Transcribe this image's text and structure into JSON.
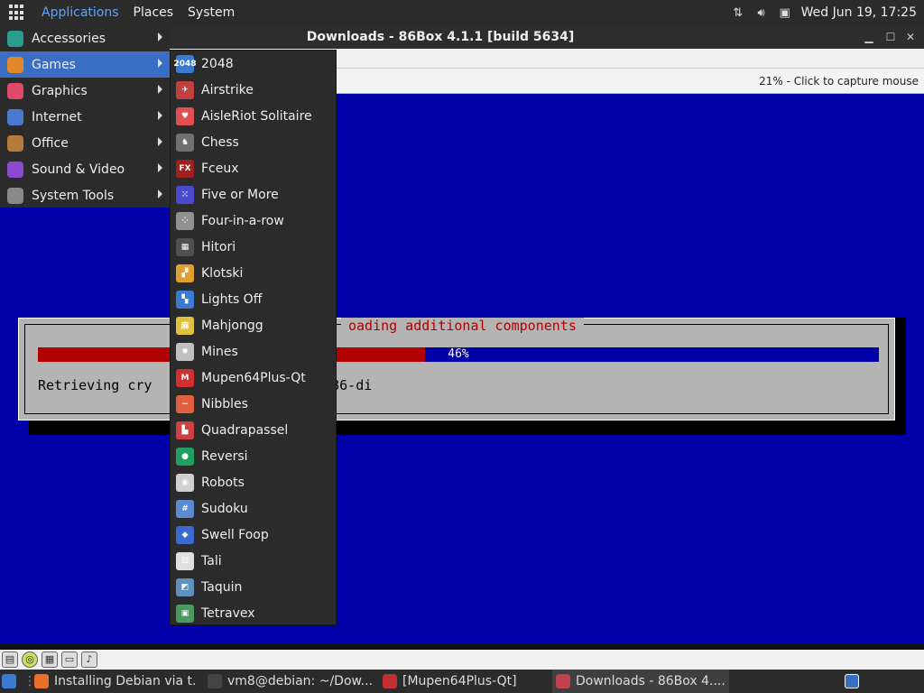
{
  "top_panel": {
    "menus": [
      "Applications",
      "Places",
      "System"
    ],
    "clock": "Wed Jun 19, 17:25"
  },
  "window": {
    "title": "Downloads - 86Box 4.1.1 [build 5634]",
    "status": "21% - Click to capture mouse"
  },
  "installer": {
    "title": "oading additional components",
    "progress_percent": 46,
    "progress_label": "46%",
    "retrieving_text": "Retrieving cry                  18-686-di"
  },
  "apps_menu": [
    {
      "label": "Accessories",
      "icon": "accessories-icon",
      "color": "#2a9d8f"
    },
    {
      "label": "Games",
      "icon": "games-icon",
      "color": "#e0882a"
    },
    {
      "label": "Graphics",
      "icon": "graphics-icon",
      "color": "#e04a6a"
    },
    {
      "label": "Internet",
      "icon": "internet-icon",
      "color": "#4a7ad0"
    },
    {
      "label": "Office",
      "icon": "office-icon",
      "color": "#b87a3a"
    },
    {
      "label": "Sound & Video",
      "icon": "sound-video-icon",
      "color": "#8a4ad0"
    },
    {
      "label": "System Tools",
      "icon": "system-tools-icon",
      "color": "#888888"
    }
  ],
  "games_menu": [
    {
      "label": "2048",
      "icon": "2048-icon",
      "color": "#3a7ad0",
      "glyph": "2048"
    },
    {
      "label": "Airstrike",
      "icon": "airstrike-icon",
      "color": "#c04040",
      "glyph": "✈"
    },
    {
      "label": "AisleRiot Solitaire",
      "icon": "aisleriot-icon",
      "color": "#e05050",
      "glyph": "♥"
    },
    {
      "label": "Chess",
      "icon": "chess-icon",
      "color": "#707070",
      "glyph": "♞"
    },
    {
      "label": "Fceux",
      "icon": "fceux-icon",
      "color": "#a02020",
      "glyph": "FX"
    },
    {
      "label": "Five or More",
      "icon": "five-or-more-icon",
      "color": "#4a4ad0",
      "glyph": "⁙"
    },
    {
      "label": "Four-in-a-row",
      "icon": "four-in-a-row-icon",
      "color": "#909090",
      "glyph": "⁘"
    },
    {
      "label": "Hitori",
      "icon": "hitori-icon",
      "color": "#505050",
      "glyph": "▦"
    },
    {
      "label": "Klotski",
      "icon": "klotski-icon",
      "color": "#e0a030",
      "glyph": "▞"
    },
    {
      "label": "Lights Off",
      "icon": "lights-off-icon",
      "color": "#3a7ad0",
      "glyph": "▚"
    },
    {
      "label": "Mahjongg",
      "icon": "mahjongg-icon",
      "color": "#e0c040",
      "glyph": "麻"
    },
    {
      "label": "Mines",
      "icon": "mines-icon",
      "color": "#c0c0c0",
      "glyph": "✹"
    },
    {
      "label": "Mupen64Plus-Qt",
      "icon": "mupen64plus-icon",
      "color": "#d03030",
      "glyph": "M"
    },
    {
      "label": "Nibbles",
      "icon": "nibbles-icon",
      "color": "#e06040",
      "glyph": "~"
    },
    {
      "label": "Quadrapassel",
      "icon": "quadrapassel-icon",
      "color": "#d04040",
      "glyph": "▙"
    },
    {
      "label": "Reversi",
      "icon": "reversi-icon",
      "color": "#20a060",
      "glyph": "●"
    },
    {
      "label": "Robots",
      "icon": "robots-icon",
      "color": "#d0d0d0",
      "glyph": "◉"
    },
    {
      "label": "Sudoku",
      "icon": "sudoku-icon",
      "color": "#5a8ad0",
      "glyph": "#"
    },
    {
      "label": "Swell Foop",
      "icon": "swell-foop-icon",
      "color": "#3a6ad0",
      "glyph": "◆"
    },
    {
      "label": "Tali",
      "icon": "tali-icon",
      "color": "#e0e0e0",
      "glyph": "⚄"
    },
    {
      "label": "Taquin",
      "icon": "taquin-icon",
      "color": "#6090c0",
      "glyph": "◩"
    },
    {
      "label": "Tetravex",
      "icon": "tetravex-icon",
      "color": "#4a9a60",
      "glyph": "▣"
    }
  ],
  "taskbar": [
    {
      "label": "Installing Debian via t...",
      "icon": "firefox-icon",
      "color": "#e8702a"
    },
    {
      "label": "vm8@debian: ~/Dow...",
      "icon": "terminal-icon",
      "color": "#444444"
    },
    {
      "label": "[Mupen64Plus-Qt]",
      "icon": "mupen64plus-icon",
      "color": "#c03030"
    },
    {
      "label": "Downloads - 86Box 4....",
      "icon": "86box-icon",
      "color": "#c04050"
    }
  ]
}
